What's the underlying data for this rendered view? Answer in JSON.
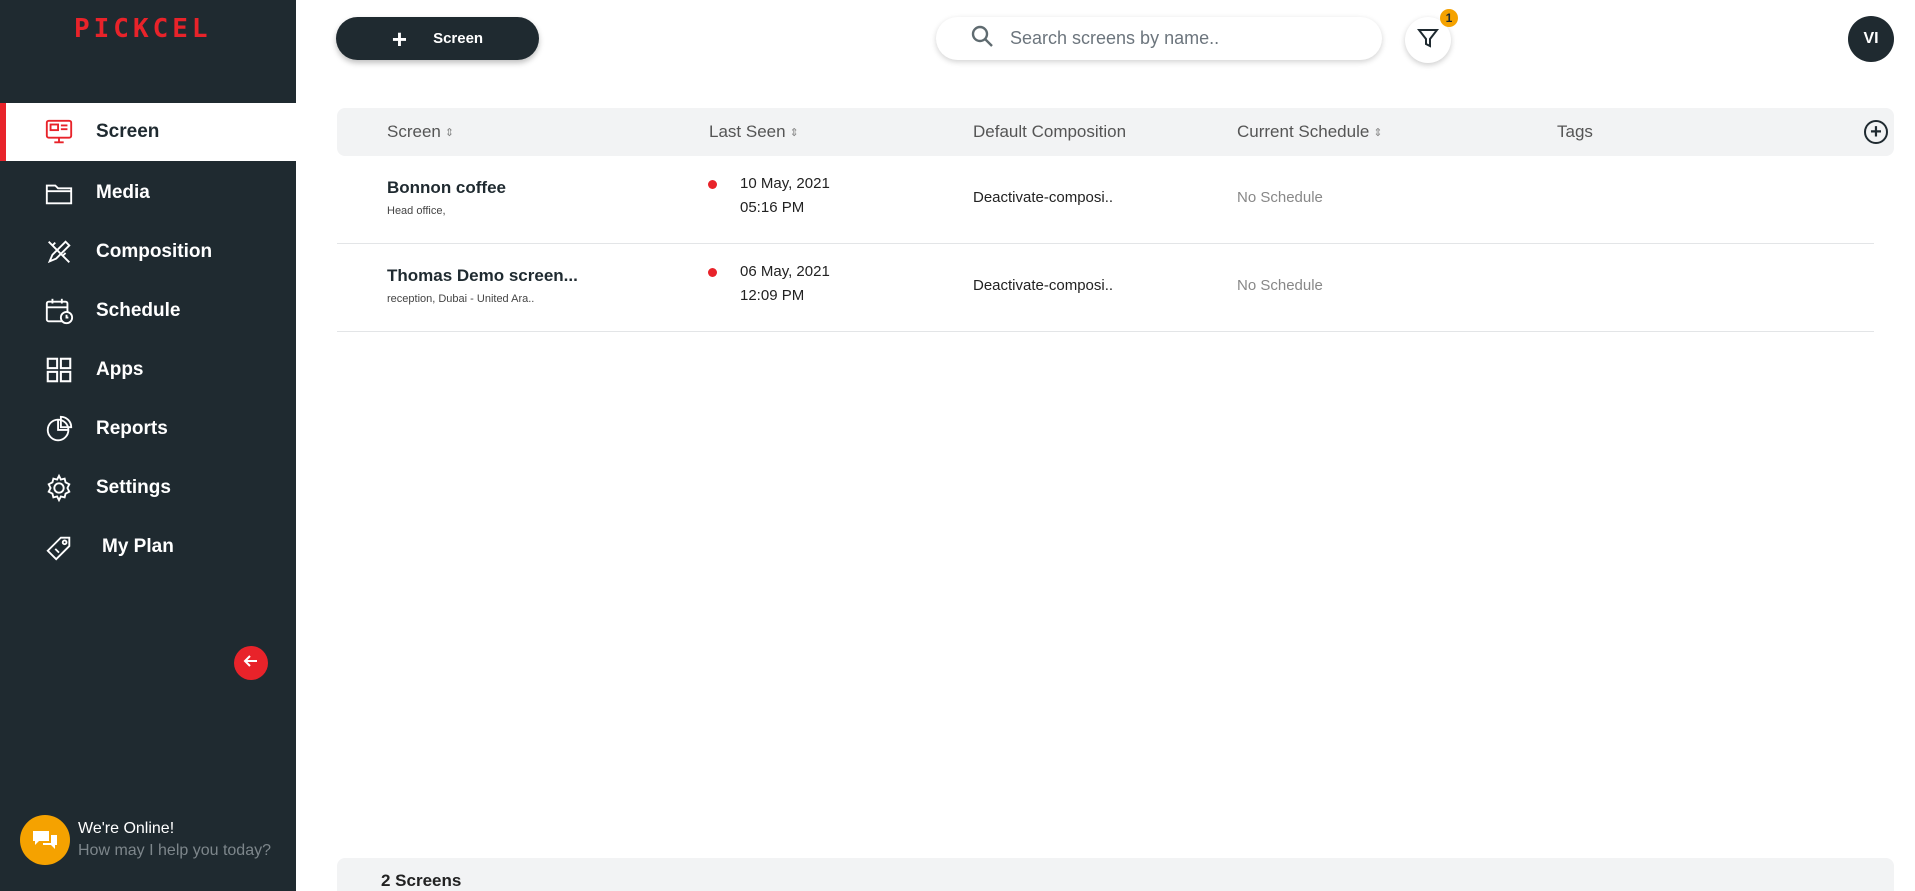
{
  "brand": {
    "logo_text": "PICKCEL",
    "accent": "#e8232a",
    "sidebar_bg": "#1f2a30"
  },
  "sidebar": {
    "items": [
      {
        "label": "Screen",
        "icon": "monitor-icon",
        "active": true
      },
      {
        "label": "Media",
        "icon": "folder-icon",
        "active": false
      },
      {
        "label": "Composition",
        "icon": "pencil-ruler-icon",
        "active": false
      },
      {
        "label": "Schedule",
        "icon": "calendar-clock-icon",
        "active": false
      },
      {
        "label": "Apps",
        "icon": "grid-icon",
        "active": false
      },
      {
        "label": "Reports",
        "icon": "pie-chart-icon",
        "active": false
      },
      {
        "label": "Settings",
        "icon": "gear-icon",
        "active": false
      },
      {
        "label": "My Plan",
        "icon": "price-tag-icon",
        "active": false
      }
    ],
    "collapse_icon": "arrow-left-icon"
  },
  "chat": {
    "title": "We're Online!",
    "subtitle": "How may I help you today?",
    "icon": "chat-bubbles-icon"
  },
  "toolbar": {
    "add_label": "Screen",
    "add_icon": "plus-icon"
  },
  "search": {
    "placeholder": "Search screens by name..",
    "value": ""
  },
  "filter": {
    "badge": "1",
    "icon": "filter-icon"
  },
  "user": {
    "initials": "VI"
  },
  "table": {
    "columns": [
      "Screen",
      "Last Seen",
      "Default Composition",
      "Current Schedule",
      "Tags"
    ],
    "rows": [
      {
        "name": "Bonnon coffee",
        "location": "Head office,",
        "date": "10 May, 2021",
        "time": "05:16 PM",
        "status": "offline",
        "composition": "Deactivate-composi..",
        "schedule": "No Schedule",
        "tags": ""
      },
      {
        "name": "Thomas Demo screen...",
        "location": "reception, Dubai - United Ara..",
        "date": "06 May, 2021",
        "time": "12:09 PM",
        "status": "offline",
        "composition": "Deactivate-composi..",
        "schedule": "No Schedule",
        "tags": ""
      }
    ]
  },
  "footer": {
    "count_label": "2 Screens"
  }
}
